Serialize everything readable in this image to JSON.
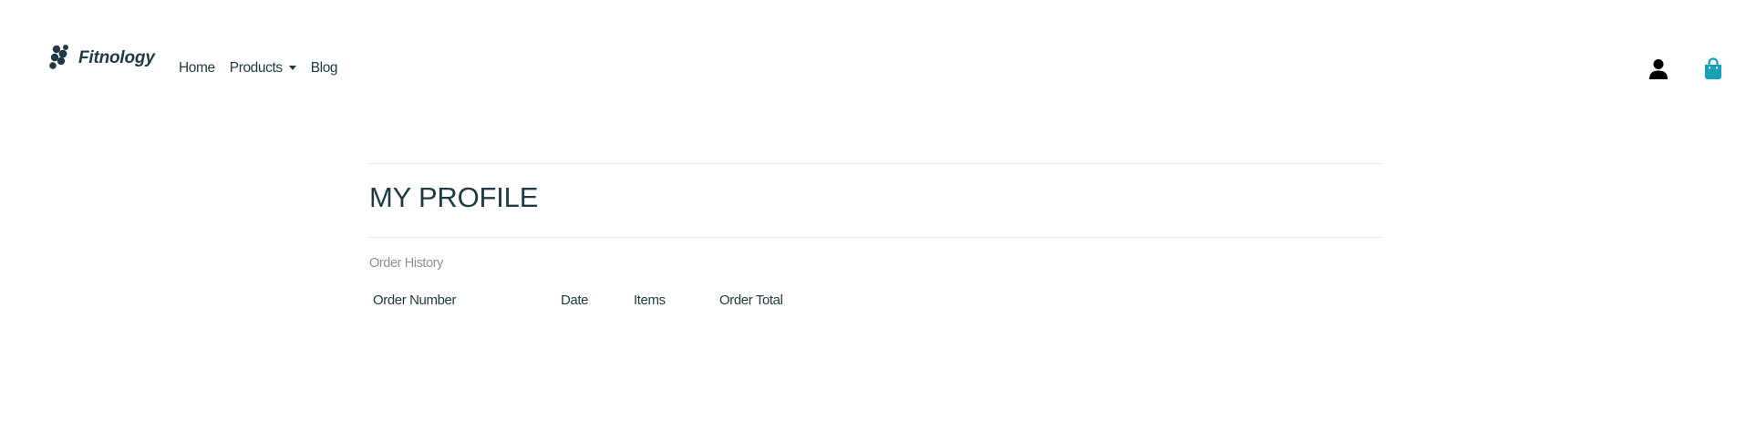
{
  "brand": {
    "name": "Fitnology"
  },
  "nav": {
    "items": [
      {
        "label": "Home"
      },
      {
        "label": "Products"
      },
      {
        "label": "Blog"
      }
    ]
  },
  "header_actions": {
    "account_icon": "user-icon",
    "bag_icon": "shopping-bag-icon",
    "bag_color": "#17a2b8"
  },
  "profile": {
    "title": "MY PROFILE",
    "section_label": "Order History",
    "columns": [
      "Order Number",
      "Date",
      "Items",
      "Order Total"
    ]
  },
  "colors": {
    "text": "#1f3a44",
    "muted": "#8b9396",
    "accent": "#17a2b8"
  }
}
